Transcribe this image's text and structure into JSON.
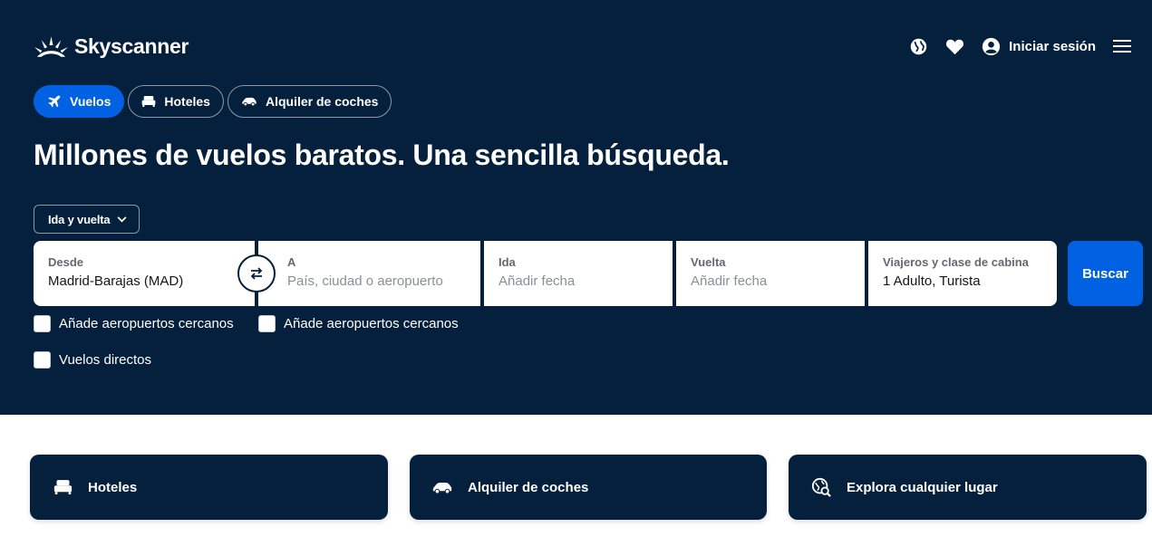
{
  "header": {
    "brand": "Skyscanner",
    "login_label": "Iniciar sesión"
  },
  "tabs": [
    {
      "label": "Vuelos",
      "icon": "plane-icon",
      "active": true
    },
    {
      "label": "Hoteles",
      "icon": "bed-icon",
      "active": false
    },
    {
      "label": "Alquiler de coches",
      "icon": "car-icon",
      "active": false
    }
  ],
  "headline": "Millones de vuelos baratos. Una sencilla búsqueda.",
  "trip_type": {
    "selected": "Ida y vuelta"
  },
  "search": {
    "desde": {
      "label": "Desde",
      "value": "Madrid-Barajas (MAD)"
    },
    "a": {
      "label": "A",
      "placeholder": "País, ciudad o aeropuerto"
    },
    "ida": {
      "label": "Ida",
      "placeholder": "Añadir fecha"
    },
    "vuelta": {
      "label": "Vuelta",
      "placeholder": "Añadir fecha"
    },
    "viajeros": {
      "label": "Viajeros y clase de cabina",
      "value": "1 Adulto, Turista"
    },
    "button_label": "Buscar"
  },
  "checkboxes": [
    {
      "label": "Añade aeropuertos cercanos",
      "checked": false
    },
    {
      "label": "Añade aeropuertos cercanos",
      "checked": false
    },
    {
      "label": "Vuelos directos",
      "checked": false
    }
  ],
  "cards": [
    {
      "label": "Hoteles",
      "icon": "bed-icon"
    },
    {
      "label": "Alquiler de coches",
      "icon": "car-icon"
    },
    {
      "label": "Explora cualquier lugar",
      "icon": "explore-globe-icon"
    }
  ],
  "colors": {
    "hero_bg": "#05203c",
    "accent": "#0062e3",
    "text_light": "#ffffff"
  }
}
